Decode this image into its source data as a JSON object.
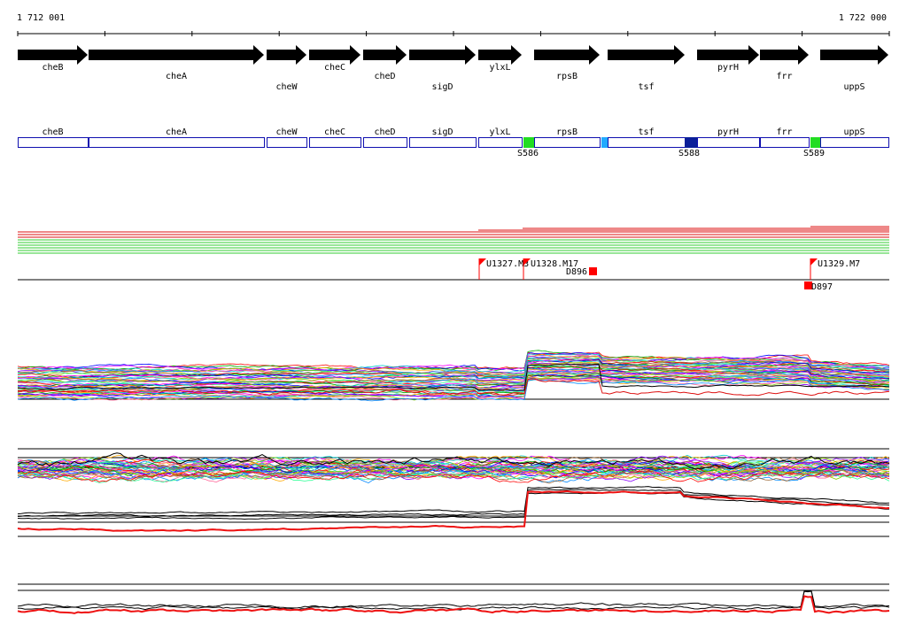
{
  "coords": {
    "start": "1 712 001",
    "end": "1 722 000"
  },
  "genes": [
    {
      "name": "cheB"
    },
    {
      "name": "cheA"
    },
    {
      "name": "cheW"
    },
    {
      "name": "cheC"
    },
    {
      "name": "cheD"
    },
    {
      "name": "sigD"
    },
    {
      "name": "ylxL"
    },
    {
      "name": "rpsB"
    },
    {
      "name": "tsf"
    },
    {
      "name": "pyrH"
    },
    {
      "name": "frr"
    },
    {
      "name": "uppS"
    }
  ],
  "sites": [
    {
      "label": "S586",
      "color": "#22dd22"
    },
    {
      "label": "",
      "color": "#22aaff"
    },
    {
      "label": "S588",
      "color": "#0b1f99"
    },
    {
      "label": "S589",
      "color": "#22dd22"
    }
  ],
  "markers": [
    {
      "label": "U1327.M3"
    },
    {
      "label": "U1328.M17"
    },
    {
      "label": "U1329.M7"
    },
    {
      "label": "D896"
    },
    {
      "label": "D897"
    }
  ],
  "colors": {
    "arrow": "#000000",
    "gene_box_stroke": "#1010b0",
    "marker": "#ff0000",
    "track_red": "#dd1111",
    "track_green": "#33cc33",
    "palette": [
      "#ff0000",
      "#00aa00",
      "#0000ff",
      "#ff00ff",
      "#00cccc",
      "#ffaa00",
      "#8800ff",
      "#88cc00",
      "#ff6699",
      "#0088ff",
      "#996633",
      "#33ff99"
    ]
  }
}
